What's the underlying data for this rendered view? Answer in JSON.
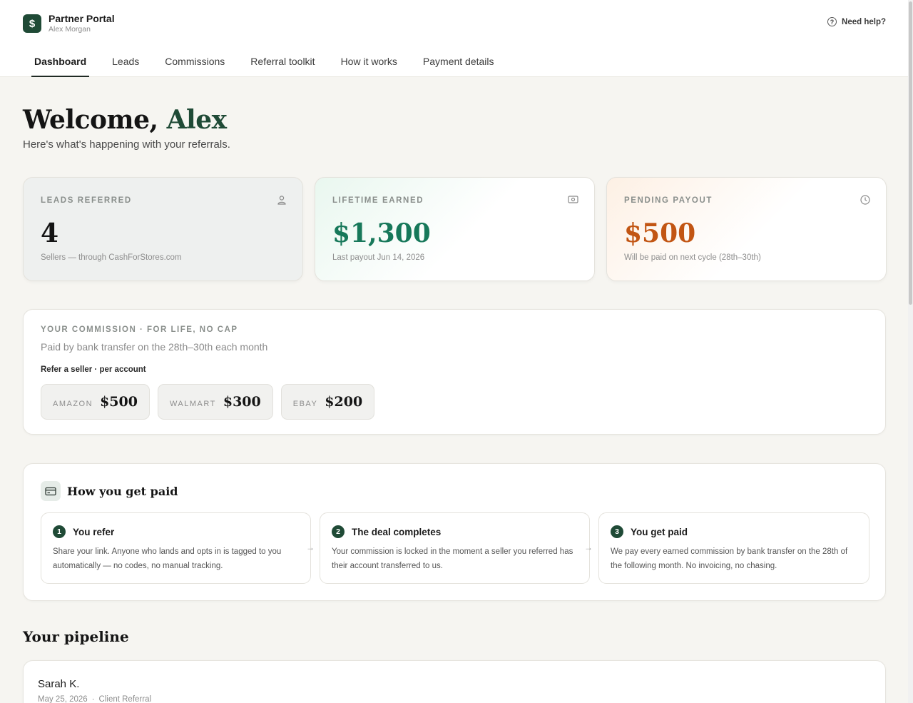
{
  "brand": {
    "title": "Partner Portal",
    "user": "Alex Morgan",
    "logo_glyph": "$"
  },
  "help": {
    "label": "Need help?",
    "icon": "question-circle-icon"
  },
  "tabs": [
    {
      "label": "Dashboard",
      "active": true
    },
    {
      "label": "Leads"
    },
    {
      "label": "Commissions"
    },
    {
      "label": "Referral toolkit"
    },
    {
      "label": "How it works"
    },
    {
      "label": "Payment details"
    }
  ],
  "welcome": {
    "greeting": "Welcome,",
    "name": "Alex",
    "subtitle": "Here's what's happening with your referrals."
  },
  "stats": {
    "leads": {
      "label": "LEADS REFERRED",
      "value": "4",
      "note": "Sellers — through CashForStores.com",
      "icon": "user-icon"
    },
    "earned": {
      "label": "LIFETIME EARNED",
      "value": "$1,300",
      "note": "Last payout Jun 14, 2026",
      "icon": "cash-icon"
    },
    "pending": {
      "label": "PENDING PAYOUT",
      "value": "$500",
      "note": "Will be paid on next cycle (28th–30th)",
      "icon": "clock-icon"
    }
  },
  "commission": {
    "eyebrow": "YOUR COMMISSION · FOR LIFE, NO CAP",
    "subtitle": "Paid by bank transfer on the 28th–30th each month",
    "refer_label": "Refer a seller · per account",
    "rates": [
      {
        "marketplace": "AMAZON",
        "amount": "$500"
      },
      {
        "marketplace": "WALMART",
        "amount": "$300"
      },
      {
        "marketplace": "EBAY",
        "amount": "$200"
      }
    ]
  },
  "how_paid": {
    "title": "How you get paid",
    "icon": "credit-card-icon",
    "steps": [
      {
        "num": "1",
        "title": "You refer",
        "desc": "Share your link. Anyone who lands and opts in is tagged to you automatically — no codes, no manual tracking."
      },
      {
        "num": "2",
        "title": "The deal completes",
        "desc": "Your commission is locked in the moment a seller you referred has their account transferred to us."
      },
      {
        "num": "3",
        "title": "You get paid",
        "desc": "We pay every earned commission by bank transfer on the 28th of the following month. No invoicing, no chasing."
      }
    ],
    "arrow_glyph": "→"
  },
  "pipeline": {
    "title": "Your pipeline",
    "leads": [
      {
        "name": "Sarah K.",
        "date": "May 25, 2026",
        "source": "Client Referral"
      }
    ]
  }
}
